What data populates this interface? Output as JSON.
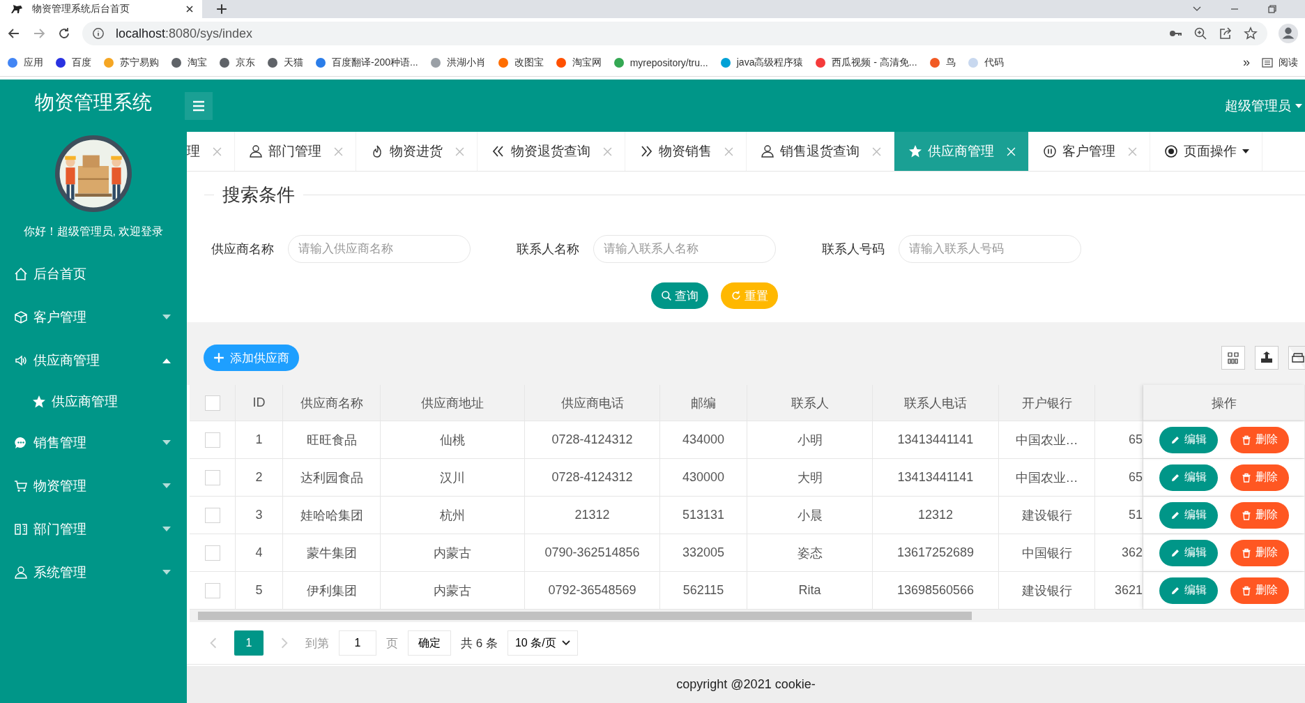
{
  "browser": {
    "tab_title": "物资管理系统后台首页",
    "url_host": "localhost",
    "url_rest": ":8080/sys/index",
    "bookmarks": [
      {
        "label": "应用",
        "color": "#4285f4"
      },
      {
        "label": "百度",
        "color": "#2932e1"
      },
      {
        "label": "苏宁易购",
        "color": "#f5a623"
      },
      {
        "label": "淘宝",
        "color": "#5f6368"
      },
      {
        "label": "京东",
        "color": "#5f6368"
      },
      {
        "label": "天猫",
        "color": "#5f6368"
      },
      {
        "label": "百度翻译-200种语...",
        "color": "#2b7de9"
      },
      {
        "label": "洪湖小肖",
        "color": "#9aa0a6"
      },
      {
        "label": "改图宝",
        "color": "#ff6d00"
      },
      {
        "label": "淘宝网",
        "color": "#ff5000"
      },
      {
        "label": "myrepository/tru...",
        "color": "#34a853"
      },
      {
        "label": "java高级程序猿",
        "color": "#00a1d6"
      },
      {
        "label": "西瓜视频 - 高清免...",
        "color": "#f53b3b"
      },
      {
        "label": "鸟",
        "color": "#f15a24"
      },
      {
        "label": "代码",
        "color": "#c8d8ef"
      }
    ],
    "more": "»",
    "reading_list": "阅读"
  },
  "header": {
    "title": "物资管理系统",
    "user": "超级管理员"
  },
  "sidebar": {
    "greeting": "你好！超级管理员, 欢迎登录",
    "items": [
      {
        "label": "后台首页",
        "kind": "home"
      },
      {
        "label": "客户管理",
        "kind": "cube",
        "expanded": false
      },
      {
        "label": "供应商管理",
        "kind": "speaker",
        "expanded": true,
        "children": [
          {
            "label": "供应商管理",
            "kind": "star"
          }
        ]
      },
      {
        "label": "销售管理",
        "kind": "chat",
        "expanded": false
      },
      {
        "label": "物资管理",
        "kind": "cart",
        "expanded": false
      },
      {
        "label": "部门管理",
        "kind": "building",
        "expanded": false
      },
      {
        "label": "系统管理",
        "kind": "user",
        "expanded": false
      }
    ]
  },
  "tabs": [
    {
      "label": "理",
      "kind": "none",
      "selected": false
    },
    {
      "label": "部门管理",
      "kind": "user",
      "selected": false
    },
    {
      "label": "物资进货",
      "kind": "fire",
      "selected": false
    },
    {
      "label": "物资退货查询",
      "kind": "double-left",
      "selected": false
    },
    {
      "label": "物资销售",
      "kind": "double-right",
      "selected": false
    },
    {
      "label": "销售退货查询",
      "kind": "user",
      "selected": false
    },
    {
      "label": "供应商管理",
      "kind": "star",
      "selected": true
    },
    {
      "label": "客户管理",
      "kind": "pause",
      "selected": false
    }
  ],
  "page_actions": "页面操作",
  "search": {
    "title": "搜索条件",
    "fields": [
      {
        "label": "供应商名称",
        "placeholder": "请输入供应商名称"
      },
      {
        "label": "联系人名称",
        "placeholder": "请输入联系人名称"
      },
      {
        "label": "联系人号码",
        "placeholder": "请输入联系人号码"
      }
    ],
    "buttons": [
      {
        "label": "查询",
        "kind": "search"
      },
      {
        "label": "重置",
        "kind": "reset"
      }
    ]
  },
  "toolbar": {
    "add_button": "添加供应商"
  },
  "table": {
    "all_checked": false,
    "columns": [
      "ID",
      "供应商名称",
      "供应商地址",
      "供应商电话",
      "邮编",
      "联系人",
      "联系人电话",
      "开户银行",
      "",
      "操作"
    ],
    "rows": [
      {
        "checked": false,
        "cells": [
          "1",
          "旺旺食品",
          "仙桃",
          "0728-4124312",
          "434000",
          "小明",
          "13413441141",
          "中国农业…",
          "65"
        ],
        "actions": [
          "编辑",
          "删除"
        ]
      },
      {
        "checked": false,
        "cells": [
          "2",
          "达利园食品",
          "汉川",
          "0728-4124312",
          "430000",
          "大明",
          "13413441141",
          "中国农业…",
          "65"
        ],
        "actions": [
          "编辑",
          "删除"
        ]
      },
      {
        "checked": false,
        "cells": [
          "3",
          "娃哈哈集团",
          "杭州",
          "21312",
          "513131",
          "小晨",
          "12312",
          "建设银行",
          "51"
        ],
        "actions": [
          "编辑",
          "删除"
        ]
      },
      {
        "checked": false,
        "cells": [
          "4",
          "蒙牛集团",
          "内蒙古",
          "0790-362514856",
          "332005",
          "姿态",
          "13617252689",
          "中国银行",
          "362"
        ],
        "actions": [
          "编辑",
          "删除"
        ]
      },
      {
        "checked": false,
        "cells": [
          "5",
          "伊利集团",
          "内蒙古",
          "0792-36548569",
          "562115",
          "Rita",
          "13698560566",
          "建设银行",
          "3621"
        ],
        "actions": [
          "编辑",
          "删除"
        ]
      }
    ]
  },
  "pagination": {
    "current": "1",
    "goto_label": "到第",
    "goto_value": "1",
    "page_unit": "页",
    "confirm": "确定",
    "total": "共 6 条",
    "page_size": "10 条/页"
  },
  "footer": "copyright @2021 cookie-"
}
